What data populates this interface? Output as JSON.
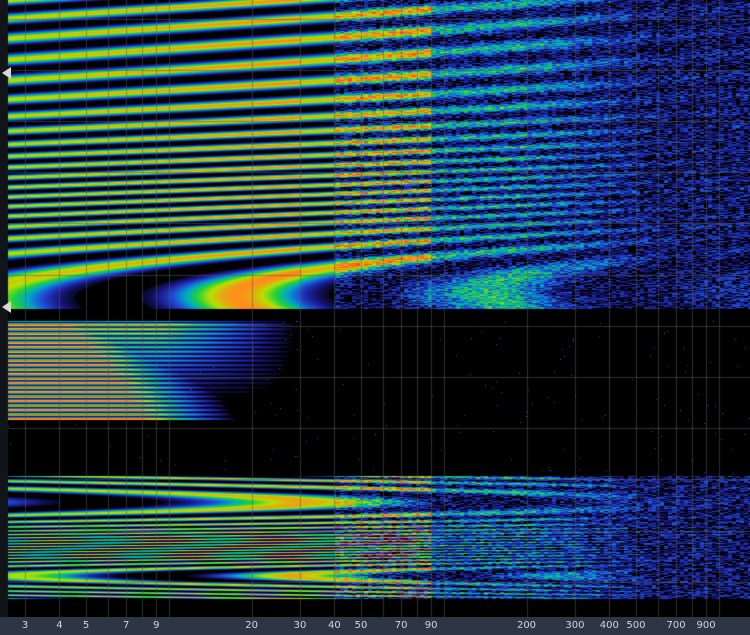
{
  "chart_data": {
    "type": "heatmap",
    "title": "",
    "xlabel": "",
    "ylabel": "",
    "x_scale": "log",
    "xlim": [
      2.6,
      1300
    ],
    "x_ticks": [
      3,
      4,
      5,
      7,
      9,
      20,
      30,
      40,
      50,
      70,
      90,
      200,
      300,
      400,
      500,
      700,
      900
    ],
    "x_tick_labels": [
      "3",
      "4",
      "5",
      "7",
      "9",
      "20",
      "30",
      "40",
      "50",
      "70",
      "90",
      "200",
      "300",
      "400",
      "500",
      "700",
      "900"
    ],
    "grid": true,
    "colormap": [
      "#000000",
      "#1a1a8c",
      "#1f4fd8",
      "#00a8c8",
      "#20d040",
      "#b8e000",
      "#ff8c1a",
      "#ff4a1a"
    ],
    "regions": [
      {
        "name": "upper-band",
        "y_range": [
          0.0,
          0.5
        ],
        "low_freq_intensity": 0.75,
        "mid_freq_intensity": 0.8,
        "high_freq_intensity": 0.35,
        "cutoff_x": 600
      },
      {
        "name": "middle-band",
        "y_range": [
          0.52,
          0.68
        ],
        "low_freq_intensity": 0.95,
        "cutoff_x": 9
      },
      {
        "name": "lower-band",
        "y_range": [
          0.77,
          0.97
        ],
        "low_freq_intensity": 0.7,
        "mid_freq_intensity": 0.8,
        "high_freq_intensity": 0.35,
        "cutoff_x": 600
      }
    ],
    "markers": [
      {
        "name": "selection-start"
      },
      {
        "name": "selection-end"
      }
    ]
  },
  "colors": {
    "background": "#000000",
    "axis_bar": "#2c3644",
    "tick_text": "#cfd6de",
    "grid": "#5a5a5a",
    "marker": "#d8d8d8"
  }
}
